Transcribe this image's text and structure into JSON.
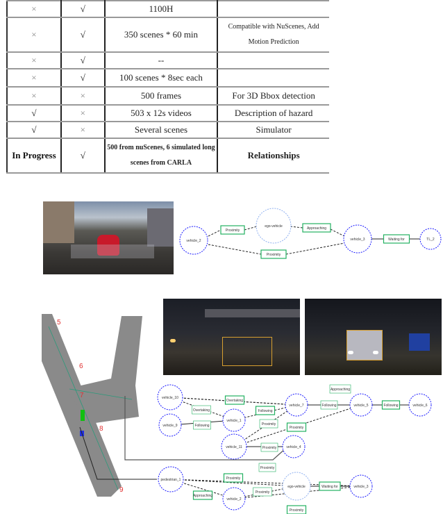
{
  "table": {
    "rows": [
      [
        "×",
        "√",
        "1100H",
        ""
      ],
      [
        "×",
        "√",
        "350 scenes * 60 min",
        "Compatible with NuScenes, Add Motion Prediction"
      ],
      [
        "×",
        "√",
        "--",
        ""
      ],
      [
        "×",
        "√",
        "100 scenes * 8sec each",
        ""
      ],
      [
        "×",
        "×",
        "500 frames",
        "For 3D Bbox detection"
      ],
      [
        "√",
        "×",
        "503 x 12s videos",
        "Description of hazard"
      ],
      [
        "√",
        "×",
        "Several scenes",
        "Simulator"
      ],
      [
        "In Progress",
        "√",
        "500 from nuScenes, 6 simulated long scenes from CARLA",
        "Relationships"
      ]
    ]
  },
  "graph_top": {
    "nodes": [
      "vehicle_2",
      "ego-vehicle",
      "vehicle_3",
      "TL_2"
    ],
    "relations": [
      "Proximity",
      "Approaching",
      "Waiting for",
      "Proximity"
    ]
  },
  "graph_bottom": {
    "nodes": [
      "vehicle_10",
      "vehicle_9",
      "vehicle_1",
      "vehicle_7",
      "vehicle_5",
      "vehicle_6",
      "vehicle_11",
      "vehicle_4",
      "pedestrian_1",
      "ego-vehicle",
      "vehicle_3",
      "vehicle_2"
    ],
    "relations": [
      "Approaching",
      "Overtaking",
      "Overtaking",
      "Following",
      "Following",
      "Following",
      "Following",
      "Proximity",
      "Proximity",
      "Approaching",
      "Proximity",
      "Proximity",
      "Proximity",
      "Approaching",
      "Waiting for",
      "Proximity",
      "Proximity",
      "Proximity"
    ]
  },
  "map_labels": [
    "5",
    "6",
    "7",
    "8",
    "9"
  ],
  "colors": {
    "node": "#1a1aff",
    "ego": "#8fb0f0",
    "box": "#22b060",
    "map_label": "#e03030",
    "road": "#8a8a8a"
  }
}
